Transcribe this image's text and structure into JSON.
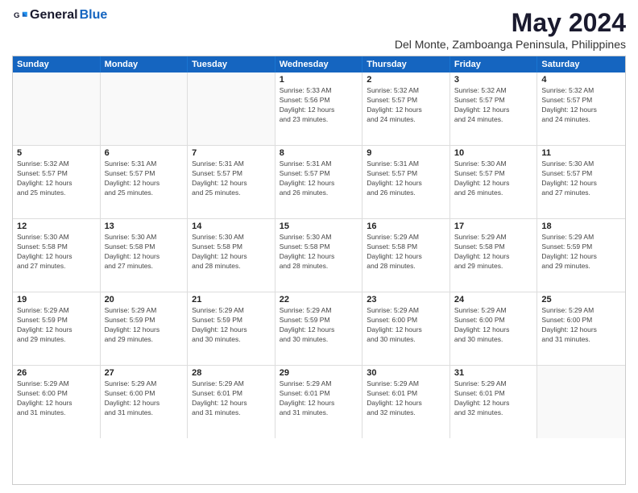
{
  "logo": {
    "general": "General",
    "blue": "Blue"
  },
  "title": "May 2024",
  "location": "Del Monte, Zamboanga Peninsula, Philippines",
  "days_of_week": [
    "Sunday",
    "Monday",
    "Tuesday",
    "Wednesday",
    "Thursday",
    "Friday",
    "Saturday"
  ],
  "weeks": [
    [
      {
        "day": "",
        "info": ""
      },
      {
        "day": "",
        "info": ""
      },
      {
        "day": "",
        "info": ""
      },
      {
        "day": "1",
        "info": "Sunrise: 5:33 AM\nSunset: 5:56 PM\nDaylight: 12 hours\nand 23 minutes."
      },
      {
        "day": "2",
        "info": "Sunrise: 5:32 AM\nSunset: 5:57 PM\nDaylight: 12 hours\nand 24 minutes."
      },
      {
        "day": "3",
        "info": "Sunrise: 5:32 AM\nSunset: 5:57 PM\nDaylight: 12 hours\nand 24 minutes."
      },
      {
        "day": "4",
        "info": "Sunrise: 5:32 AM\nSunset: 5:57 PM\nDaylight: 12 hours\nand 24 minutes."
      }
    ],
    [
      {
        "day": "5",
        "info": "Sunrise: 5:32 AM\nSunset: 5:57 PM\nDaylight: 12 hours\nand 25 minutes."
      },
      {
        "day": "6",
        "info": "Sunrise: 5:31 AM\nSunset: 5:57 PM\nDaylight: 12 hours\nand 25 minutes."
      },
      {
        "day": "7",
        "info": "Sunrise: 5:31 AM\nSunset: 5:57 PM\nDaylight: 12 hours\nand 25 minutes."
      },
      {
        "day": "8",
        "info": "Sunrise: 5:31 AM\nSunset: 5:57 PM\nDaylight: 12 hours\nand 26 minutes."
      },
      {
        "day": "9",
        "info": "Sunrise: 5:31 AM\nSunset: 5:57 PM\nDaylight: 12 hours\nand 26 minutes."
      },
      {
        "day": "10",
        "info": "Sunrise: 5:30 AM\nSunset: 5:57 PM\nDaylight: 12 hours\nand 26 minutes."
      },
      {
        "day": "11",
        "info": "Sunrise: 5:30 AM\nSunset: 5:57 PM\nDaylight: 12 hours\nand 27 minutes."
      }
    ],
    [
      {
        "day": "12",
        "info": "Sunrise: 5:30 AM\nSunset: 5:58 PM\nDaylight: 12 hours\nand 27 minutes."
      },
      {
        "day": "13",
        "info": "Sunrise: 5:30 AM\nSunset: 5:58 PM\nDaylight: 12 hours\nand 27 minutes."
      },
      {
        "day": "14",
        "info": "Sunrise: 5:30 AM\nSunset: 5:58 PM\nDaylight: 12 hours\nand 28 minutes."
      },
      {
        "day": "15",
        "info": "Sunrise: 5:30 AM\nSunset: 5:58 PM\nDaylight: 12 hours\nand 28 minutes."
      },
      {
        "day": "16",
        "info": "Sunrise: 5:29 AM\nSunset: 5:58 PM\nDaylight: 12 hours\nand 28 minutes."
      },
      {
        "day": "17",
        "info": "Sunrise: 5:29 AM\nSunset: 5:58 PM\nDaylight: 12 hours\nand 29 minutes."
      },
      {
        "day": "18",
        "info": "Sunrise: 5:29 AM\nSunset: 5:59 PM\nDaylight: 12 hours\nand 29 minutes."
      }
    ],
    [
      {
        "day": "19",
        "info": "Sunrise: 5:29 AM\nSunset: 5:59 PM\nDaylight: 12 hours\nand 29 minutes."
      },
      {
        "day": "20",
        "info": "Sunrise: 5:29 AM\nSunset: 5:59 PM\nDaylight: 12 hours\nand 29 minutes."
      },
      {
        "day": "21",
        "info": "Sunrise: 5:29 AM\nSunset: 5:59 PM\nDaylight: 12 hours\nand 30 minutes."
      },
      {
        "day": "22",
        "info": "Sunrise: 5:29 AM\nSunset: 5:59 PM\nDaylight: 12 hours\nand 30 minutes."
      },
      {
        "day": "23",
        "info": "Sunrise: 5:29 AM\nSunset: 6:00 PM\nDaylight: 12 hours\nand 30 minutes."
      },
      {
        "day": "24",
        "info": "Sunrise: 5:29 AM\nSunset: 6:00 PM\nDaylight: 12 hours\nand 30 minutes."
      },
      {
        "day": "25",
        "info": "Sunrise: 5:29 AM\nSunset: 6:00 PM\nDaylight: 12 hours\nand 31 minutes."
      }
    ],
    [
      {
        "day": "26",
        "info": "Sunrise: 5:29 AM\nSunset: 6:00 PM\nDaylight: 12 hours\nand 31 minutes."
      },
      {
        "day": "27",
        "info": "Sunrise: 5:29 AM\nSunset: 6:00 PM\nDaylight: 12 hours\nand 31 minutes."
      },
      {
        "day": "28",
        "info": "Sunrise: 5:29 AM\nSunset: 6:01 PM\nDaylight: 12 hours\nand 31 minutes."
      },
      {
        "day": "29",
        "info": "Sunrise: 5:29 AM\nSunset: 6:01 PM\nDaylight: 12 hours\nand 31 minutes."
      },
      {
        "day": "30",
        "info": "Sunrise: 5:29 AM\nSunset: 6:01 PM\nDaylight: 12 hours\nand 32 minutes."
      },
      {
        "day": "31",
        "info": "Sunrise: 5:29 AM\nSunset: 6:01 PM\nDaylight: 12 hours\nand 32 minutes."
      },
      {
        "day": "",
        "info": ""
      }
    ]
  ]
}
